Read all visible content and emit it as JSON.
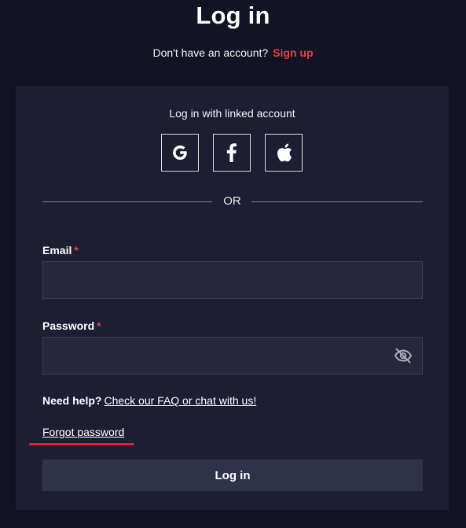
{
  "header": {
    "title": "Log in",
    "signup_prompt": "Don't have an account?",
    "signup_link": "Sign up"
  },
  "social": {
    "label": "Log in with linked account",
    "buttons": [
      {
        "name": "Google",
        "icon": "google-icon"
      },
      {
        "name": "Facebook",
        "icon": "facebook-icon"
      },
      {
        "name": "Apple",
        "icon": "apple-icon"
      }
    ],
    "divider_text": "OR"
  },
  "form": {
    "email_label": "Email",
    "email_value": "",
    "password_label": "Password",
    "password_value": "",
    "required_marker": "*",
    "password_toggle_icon": "eye-slash-icon",
    "help_strong": "Need help?",
    "help_link": "Check our FAQ or chat with us!",
    "forgot_link": "Forgot password",
    "submit_label": "Log in"
  },
  "colors": {
    "background": "#131423",
    "card": "#1d1e32",
    "accent": "#e2404b",
    "button": "#30324a",
    "highlight_underline": "#e0202a"
  }
}
